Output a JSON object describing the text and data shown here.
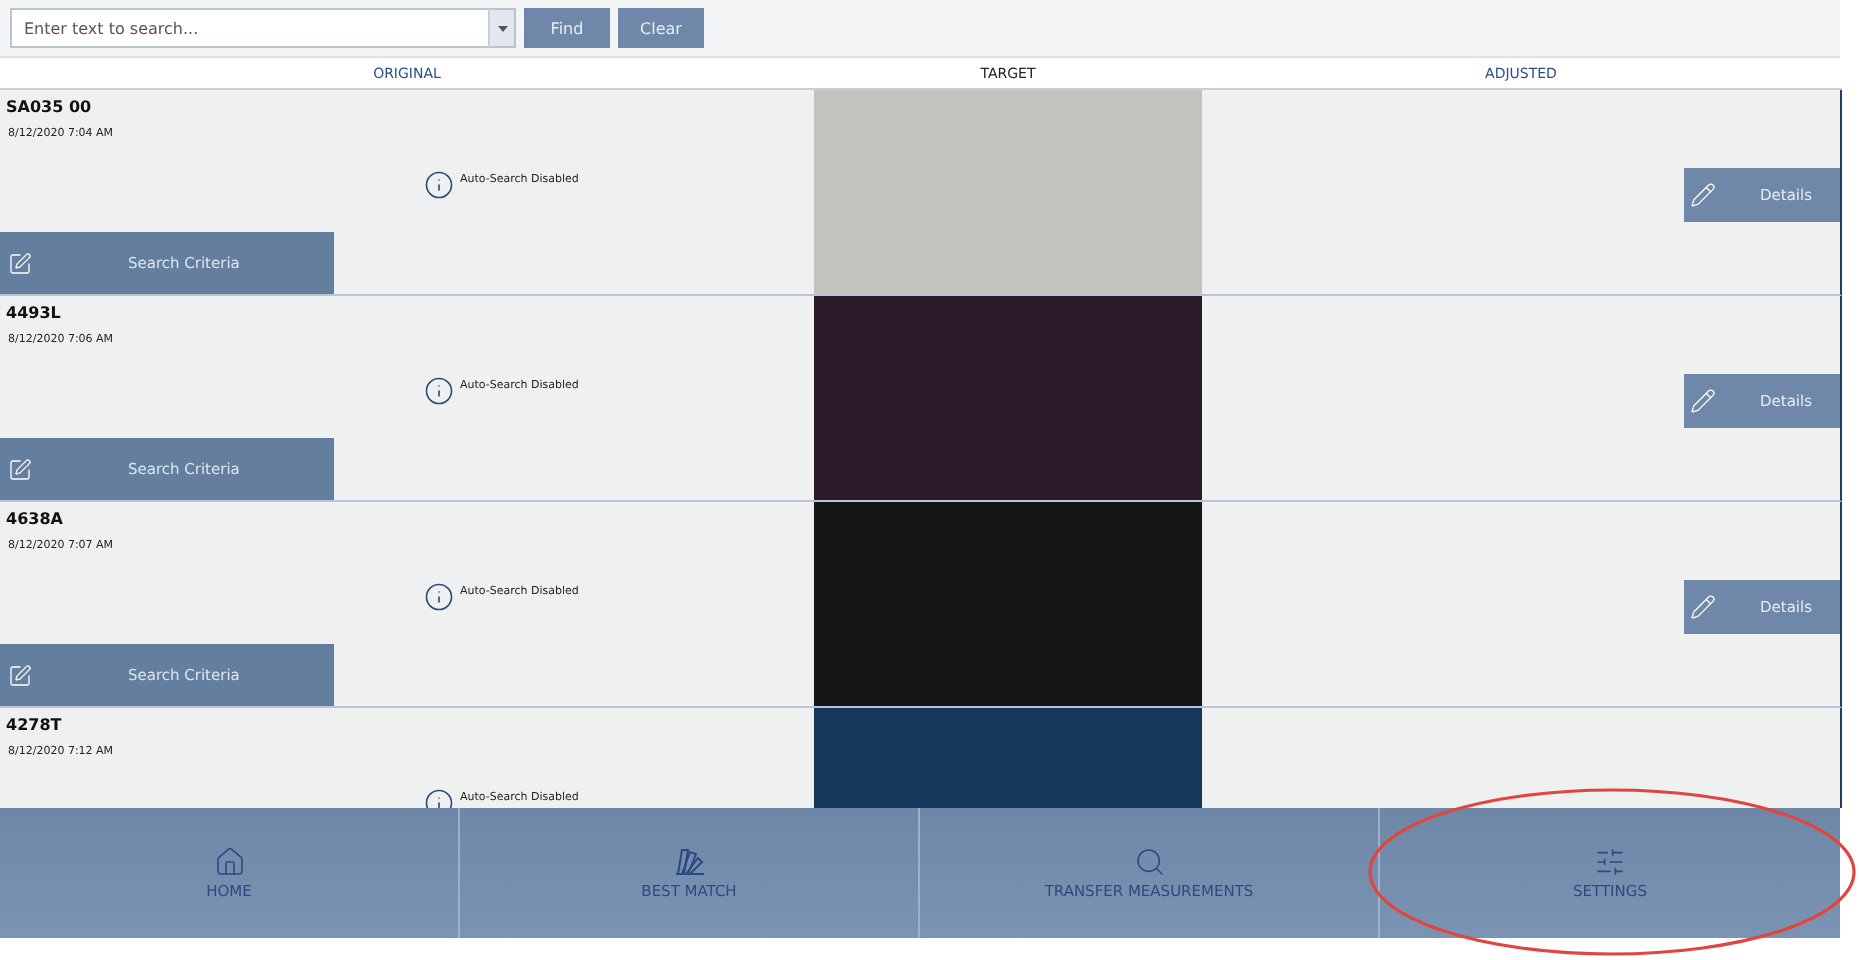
{
  "search": {
    "placeholder": "Enter text to search...",
    "buttons": [
      "Find",
      "Clear"
    ]
  },
  "columns": [
    "ORIGINAL",
    "TARGET",
    "ADJUSTED"
  ],
  "rows": [
    {
      "name": "SA035 00",
      "date": "8/12/2020 7:04 AM",
      "status": "Auto-Search Disabled",
      "color": "#c4c4bf",
      "search_button": "Search Criteria",
      "details_button": "Details"
    },
    {
      "name": "4493L",
      "date": "8/12/2020 7:06 AM",
      "status": "Auto-Search Disabled",
      "color": "#2b1b2c",
      "search_button": "Search Criteria",
      "details_button": "Details"
    },
    {
      "name": "4638A",
      "date": "8/12/2020 7:07 AM",
      "status": "Auto-Search Disabled",
      "color": "#161616",
      "search_button": "Search Criteria",
      "details_button": "Details"
    },
    {
      "name": "4278T",
      "date": "8/12/2020 7:12 AM",
      "status": "Auto-Search Disabled",
      "color": "#15375a"
    }
  ],
  "nav": [
    {
      "kind": "home",
      "label": "HOME"
    },
    {
      "kind": "best-match",
      "label": "BEST MATCH"
    },
    {
      "kind": "search",
      "label": "TRANSFER MEASUREMENTS"
    },
    {
      "kind": "settings",
      "label": "SETTINGS"
    }
  ]
}
